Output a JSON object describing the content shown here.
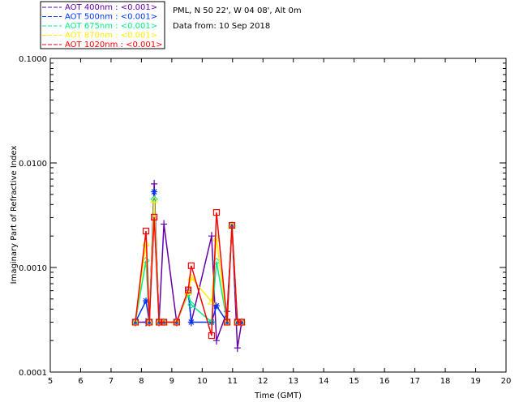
{
  "chart_data": {
    "type": "line",
    "title_lines": [
      "PML, N 50 22', W 04 08', Alt 0m",
      "Data from: 10 Sep 2018"
    ],
    "xlabel": "Time (GMT)",
    "ylabel": "Imaginary Part of Refractive Index",
    "xlim": [
      5,
      20
    ],
    "ylim": [
      0.0001,
      0.1
    ],
    "yscale": "log",
    "xticks": [
      "5",
      "6",
      "7",
      "8",
      "9",
      "10",
      "11",
      "12",
      "13",
      "14",
      "15",
      "16",
      "17",
      "18",
      "19",
      "20"
    ],
    "yticks": [
      "0.0001",
      "0.0010",
      "0.0100",
      "0.1000"
    ],
    "legend_position": "top-left",
    "x": [
      7.8,
      8.15,
      8.26,
      8.42,
      8.58,
      8.74,
      9.16,
      9.54,
      9.64,
      10.31,
      10.47,
      10.82,
      10.98,
      11.16,
      11.3
    ],
    "series": [
      {
        "name": "AOT  400nm : <0.001>",
        "color": "#6600aa",
        "marker": "plus",
        "values": [
          0.0003,
          0.0003,
          0.0003,
          0.0063,
          0.0003,
          0.0026,
          0.0003,
          0.0006,
          0.0003,
          0.002,
          0.0002,
          0.00038,
          0.0025,
          0.00017,
          0.0003
        ]
      },
      {
        "name": "AOT  500nm : <0.001>",
        "color": "#0033ff",
        "marker": "asterisk",
        "values": [
          0.0003,
          0.00048,
          0.0003,
          0.0053,
          0.0003,
          0.0003,
          0.0003,
          0.0006,
          0.0003,
          0.0003,
          0.00043,
          0.0003,
          0.0025,
          0.0003,
          0.0003
        ]
      },
      {
        "name": "AOT  675nm : <0.001>",
        "color": "#00ee88",
        "marker": "diamond",
        "values": [
          0.0003,
          0.00116,
          0.0003,
          0.0045,
          0.0003,
          0.0003,
          0.0003,
          0.00056,
          0.00044,
          0.0003,
          0.00114,
          0.0003,
          0.0025,
          0.0003,
          0.0003
        ]
      },
      {
        "name": "AOT  870nm : <0.001>",
        "color": "#ffee00",
        "marker": "triangle",
        "values": [
          0.0003,
          0.0017,
          0.0003,
          0.0044,
          0.0003,
          0.0003,
          0.0003,
          0.00058,
          0.0008,
          0.00047,
          0.0019,
          0.0003,
          0.0025,
          0.0003,
          0.0003
        ]
      },
      {
        "name": "AOT 1020nm : <0.001>",
        "color": "#ff0000",
        "marker": "square",
        "values": [
          0.0003,
          0.00223,
          0.0003,
          0.00303,
          0.0003,
          0.0003,
          0.0003,
          0.00061,
          0.00104,
          0.000223,
          0.00336,
          0.0003,
          0.00253,
          0.0003,
          0.0003
        ]
      }
    ]
  }
}
